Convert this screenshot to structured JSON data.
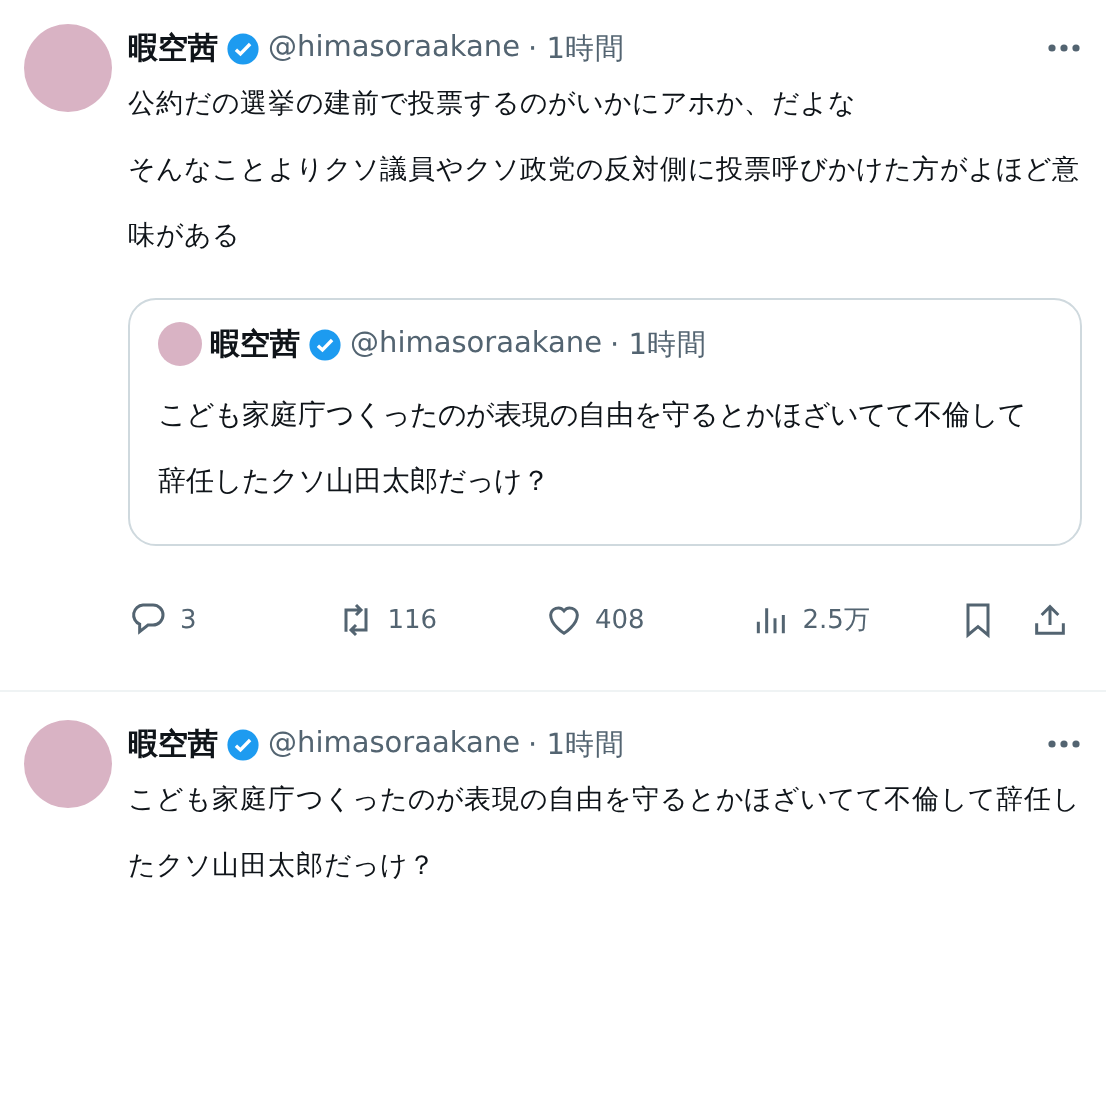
{
  "tweets": [
    {
      "name": "暇空茜",
      "handle": "@himasoraakane",
      "time": "· 1時間",
      "verified": true,
      "text": [
        "公約だの選挙の建前で投票するのがいかにアホか、だよな",
        "そんなことよりクソ議員やクソ政党の反対側に投票呼びかけた方がよほど意味がある"
      ],
      "quote": {
        "name": "暇空茜",
        "handle": "@himasoraakane",
        "time": "· 1時間",
        "verified": true,
        "text": "こども家庭庁つくったのが表現の自由を守るとかほざいてて不倫して辞任したクソ山田太郎だっけ？"
      },
      "actions": [
        {
          "kind": "reply",
          "count": "3"
        },
        {
          "kind": "retweet",
          "count": "116"
        },
        {
          "kind": "like",
          "count": "408"
        },
        {
          "kind": "views",
          "count": "2.5万"
        }
      ]
    },
    {
      "name": "暇空茜",
      "handle": "@himasoraakane",
      "time": "· 1時間",
      "verified": true,
      "text": [
        "こども家庭庁つくったのが表現の自由を守るとかほざいてて不倫して辞任したクソ山田太郎だっけ？"
      ]
    }
  ]
}
